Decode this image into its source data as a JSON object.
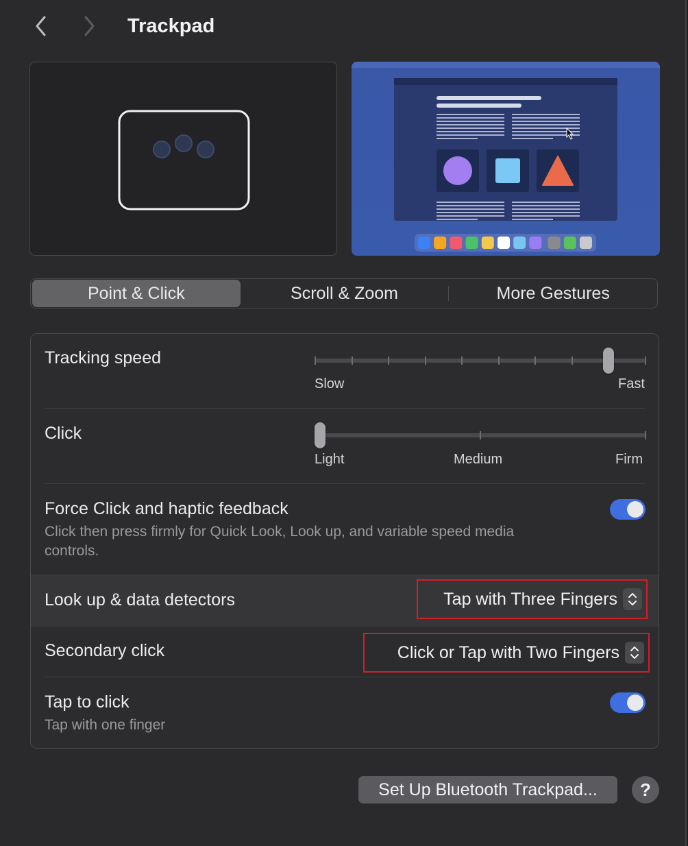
{
  "window": {
    "title": "Trackpad",
    "accent_color": "#3f6ee0",
    "highlight_border_color": "#d01f25"
  },
  "nav": {
    "back_icon": "chevron-left-icon",
    "forward_icon": "chevron-right-icon"
  },
  "tabs": [
    {
      "label": "Point & Click",
      "active": true
    },
    {
      "label": "Scroll & Zoom",
      "active": false
    },
    {
      "label": "More Gestures",
      "active": false
    }
  ],
  "settings": {
    "tracking_speed": {
      "label": "Tracking speed",
      "min_label": "Slow",
      "max_label": "Fast",
      "value_index": 8,
      "steps": 10
    },
    "click": {
      "label": "Click",
      "labels": [
        "Light",
        "Medium",
        "Firm"
      ],
      "value_index": 0,
      "steps": 3
    },
    "force_click": {
      "label": "Force Click and haptic feedback",
      "description": "Click then press firmly for Quick Look, Look up, and variable speed media controls.",
      "enabled": true
    },
    "look_up": {
      "label": "Look up & data detectors",
      "value": "Tap with Three Fingers"
    },
    "secondary_click": {
      "label": "Secondary click",
      "value": "Click or Tap with Two Fingers"
    },
    "tap_to_click": {
      "label": "Tap to click",
      "description": "Tap with one finger",
      "enabled": true
    }
  },
  "footer": {
    "bluetooth_button": "Set Up Bluetooth Trackpad...",
    "help_button": "?"
  },
  "preview": {
    "dock_colors": [
      "#3b82f6",
      "#f5a623",
      "#ef5a6f",
      "#4cc26a",
      "#f2c94c",
      "#ffffff",
      "#78c5f0",
      "#9b7cf4",
      "#8a8a8e",
      "#58c25b",
      "#c9c9cc"
    ]
  }
}
